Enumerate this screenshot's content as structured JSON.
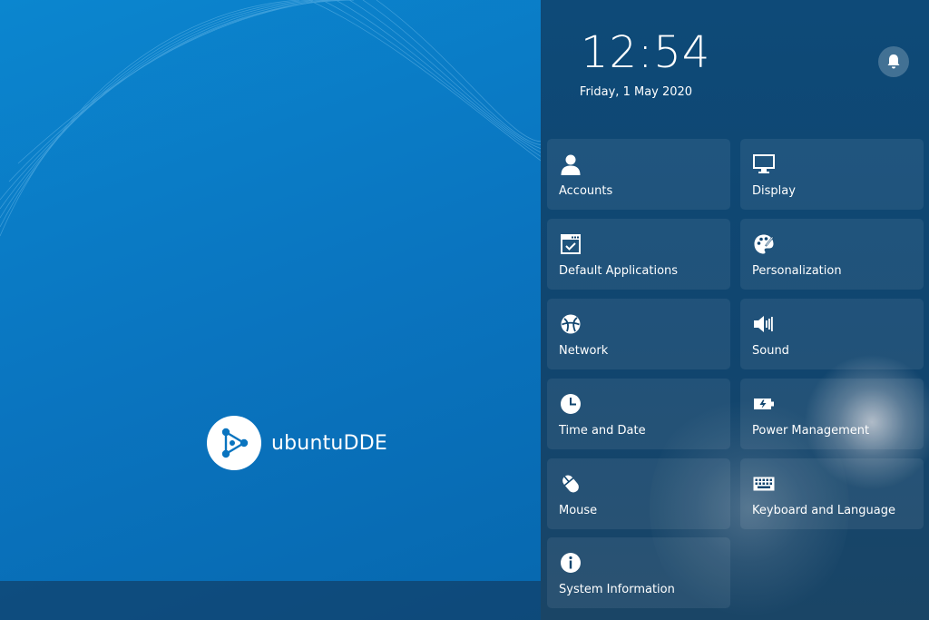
{
  "clock": {
    "time": "12:54",
    "date": "Friday, 1 May 2020"
  },
  "branding": {
    "logo_text": "ubuntuDDE"
  },
  "settings_tiles": [
    {
      "label": "Accounts",
      "icon": "user-icon"
    },
    {
      "label": "Display",
      "icon": "monitor-icon"
    },
    {
      "label": "Default Applications",
      "icon": "app-window-check-icon"
    },
    {
      "label": "Personalization",
      "icon": "palette-icon"
    },
    {
      "label": "Network",
      "icon": "network-globe-icon"
    },
    {
      "label": "Sound",
      "icon": "speaker-icon"
    },
    {
      "label": "Time and Date",
      "icon": "clock-icon"
    },
    {
      "label": "Power Management",
      "icon": "battery-icon"
    },
    {
      "label": "Mouse",
      "icon": "mouse-icon"
    },
    {
      "label": "Keyboard and Language",
      "icon": "keyboard-icon"
    },
    {
      "label": "System Information",
      "icon": "info-icon"
    }
  ],
  "colors": {
    "desktop_blue": "#0a74bf",
    "panel_navy": "#10456f",
    "text": "#ffffff"
  }
}
